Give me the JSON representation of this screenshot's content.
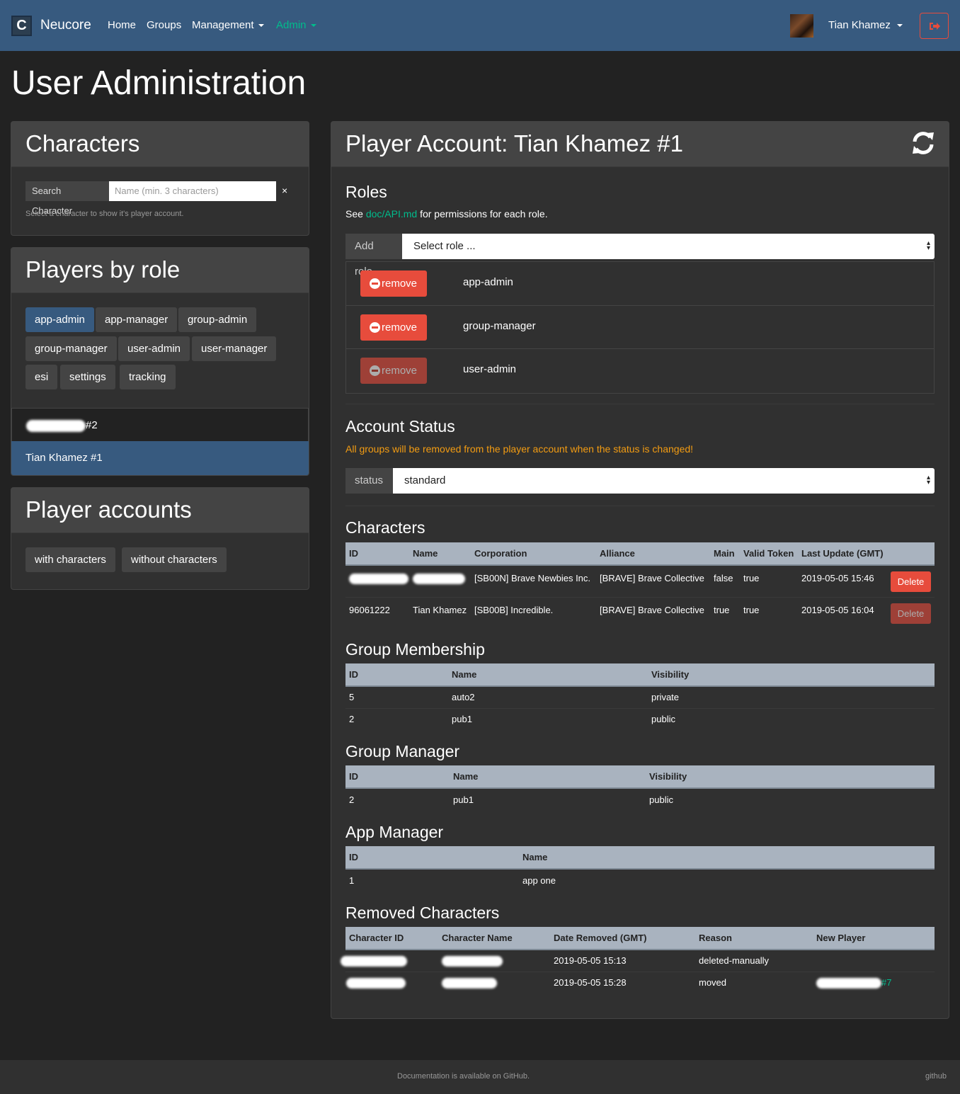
{
  "nav": {
    "brand_letter": "C",
    "brand": "Neucore",
    "home": "Home",
    "groups": "Groups",
    "management": "Management",
    "admin": "Admin",
    "user_name": "Tian Khamez"
  },
  "page_title": "User Administration",
  "characters_card": {
    "title": "Characters",
    "search_label": "Search Character",
    "search_placeholder": "Name (min. 3 characters)",
    "clear": "×",
    "help": "Select a character to show it's player account."
  },
  "players_by_role": {
    "title": "Players by role",
    "roles": [
      "app-admin",
      "app-manager",
      "group-admin",
      "group-manager",
      "user-admin",
      "user-manager",
      "esi",
      "settings",
      "tracking"
    ],
    "active_role": "app-admin",
    "players": [
      "#2",
      "Tian Khamez #1"
    ]
  },
  "player_accounts": {
    "title": "Player accounts",
    "buttons": [
      "with characters",
      "without characters"
    ]
  },
  "player_panel": {
    "title": "Player Account: Tian Khamez #1",
    "roles_title": "Roles",
    "roles_see": "See ",
    "roles_link": "doc/API.md",
    "roles_after": " for permissions for each role.",
    "add_role_label": "Add role",
    "add_role_select": "Select role ...",
    "remove_label": "remove",
    "assigned_roles": [
      "app-admin",
      "group-manager",
      "user-admin"
    ],
    "account_status_title": "Account Status",
    "account_status_warning": "All groups will be removed from the player account when the status is changed!",
    "status_label": "status",
    "status_value": "standard",
    "characters_title": "Characters",
    "characters_headers": [
      "ID",
      "Name",
      "Corporation",
      "Alliance",
      "Main",
      "Valid Token",
      "Last Update (GMT)",
      ""
    ],
    "characters_rows": [
      {
        "id": "",
        "name": "",
        "corporation": "[SB00N] Brave Newbies Inc.",
        "alliance": "[BRAVE] Brave Collective",
        "main": "false",
        "valid_token": "true",
        "last_update": "2019-05-05 15:46",
        "action": "Delete"
      },
      {
        "id": "96061222",
        "name": "Tian Khamez",
        "corporation": "[SB00B] Incredible.",
        "alliance": "[BRAVE] Brave Collective",
        "main": "true",
        "valid_token": "true",
        "last_update": "2019-05-05 16:04",
        "action": "Delete"
      }
    ],
    "group_membership_title": "Group Membership",
    "group_membership_headers": [
      "ID",
      "Name",
      "Visibility"
    ],
    "group_membership_rows": [
      {
        "id": "5",
        "name": "auto2",
        "visibility": "private"
      },
      {
        "id": "2",
        "name": "pub1",
        "visibility": "public"
      }
    ],
    "group_manager_title": "Group Manager",
    "group_manager_headers": [
      "ID",
      "Name",
      "Visibility"
    ],
    "group_manager_rows": [
      {
        "id": "2",
        "name": "pub1",
        "visibility": "public"
      }
    ],
    "app_manager_title": "App Manager",
    "app_manager_headers": [
      "ID",
      "Name"
    ],
    "app_manager_rows": [
      {
        "id": "1",
        "name": "app one"
      }
    ],
    "removed_title": "Removed Characters",
    "removed_headers": [
      "Character ID",
      "Character Name",
      "Date Removed (GMT)",
      "Reason",
      "New Player"
    ],
    "removed_rows": [
      {
        "date": "2019-05-05 15:13",
        "reason": "deleted-manually",
        "new_player": ""
      },
      {
        "date": "2019-05-05 15:28",
        "reason": "moved",
        "new_player": "#7"
      }
    ]
  },
  "footer": {
    "text": "Documentation is available on GitHub.",
    "link": "github"
  },
  "colors": {
    "navbar": "#375a7f",
    "accent_green": "#00bc8c",
    "danger": "#e74c3c",
    "warning": "#f39c12"
  }
}
